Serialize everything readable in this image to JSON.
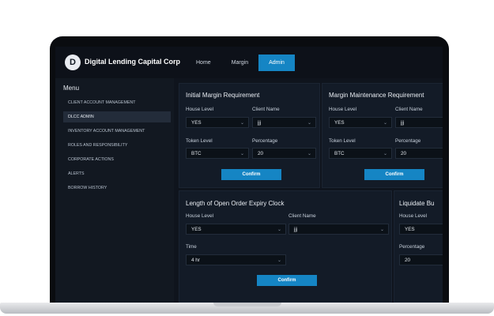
{
  "header": {
    "logo_letter": "D",
    "brand": "Digital Lending Capital Corp",
    "tabs": [
      {
        "label": "Home"
      },
      {
        "label": "Margin"
      },
      {
        "label": "Admin"
      }
    ],
    "active_tab": "Admin"
  },
  "sidebar": {
    "title": "Menu",
    "items": [
      {
        "label": "CLIENT ACCOUNT MANAGEMENT"
      },
      {
        "label": "DLCC ADMIN"
      },
      {
        "label": "INVENTORY ACCOUNT MANAGEMENT"
      },
      {
        "label": "ROLES AND RESPONSIBILITY"
      },
      {
        "label": "CORPORATE ACTIONS"
      },
      {
        "label": "ALERTS"
      },
      {
        "label": "BORROW HISTORY"
      }
    ]
  },
  "cards": {
    "initial_margin": {
      "title": "Initial Margin Requirement",
      "house_level_label": "House Level",
      "house_level_value": "YES",
      "client_name_label": "Client Name",
      "client_name_value": "jjj",
      "token_level_label": "Token Level",
      "token_level_value": "BTC",
      "percentage_label": "Percentage",
      "percentage_value": "20",
      "confirm_label": "Confirm"
    },
    "margin_maintenance": {
      "title": "Margin Maintenance Requirement",
      "house_level_label": "House Level",
      "house_level_value": "YES",
      "client_name_label": "Client Name",
      "client_name_value": "jjj",
      "token_level_label": "Token Level",
      "token_level_value": "BTC",
      "percentage_label": "Percentage",
      "percentage_value": "20",
      "confirm_label": "Confirm"
    },
    "open_order_expiry": {
      "title": "Length of Open Order Expiry Clock",
      "house_level_label": "House Level",
      "house_level_value": "YES",
      "client_name_label": "Client Name",
      "client_name_value": "jjj",
      "time_label": "Time",
      "time_value": "4 hr",
      "confirm_label": "Confirm"
    },
    "liquidate": {
      "title": "Liquidate Bu",
      "house_level_label": "House Level",
      "house_level_value": "YES",
      "percentage_label": "Percentage",
      "percentage_value": "20"
    }
  },
  "icons": {
    "dropdown": "chevron-down-icon"
  },
  "colors": {
    "accent": "#1585c4",
    "background": "#0f141d",
    "card": "#131b27"
  }
}
